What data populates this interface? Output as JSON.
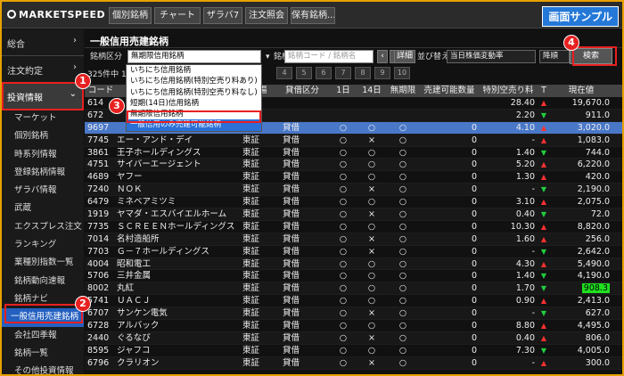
{
  "app": {
    "logo": "MARKETSPEED II",
    "sample_label": "画面サンプル"
  },
  "toolbar": {
    "buttons": [
      "個別銘柄",
      "チャート",
      "ザラバ7",
      "注文照会",
      "保有銘柄..."
    ]
  },
  "sidebar": {
    "top_items": [
      "総合",
      "注文約定",
      "投資情報"
    ],
    "items": [
      "マーケット",
      "個別銘柄",
      "時系列情報",
      "登録銘柄情報",
      "ザラバ情報",
      "武蔵",
      "エクスプレス注文",
      "ランキング",
      "業種別指数一覧",
      "銘柄動向速報",
      "銘柄ナビ",
      "一般信用売建銘柄",
      "会社四季報",
      "銘柄一覧",
      "その他投資情報"
    ],
    "selected_index": 11
  },
  "panel": {
    "title": "一般信用売建銘柄",
    "filter_label": "銘柄区分",
    "filter_value": "無期限信用銘柄",
    "stock_label": "銘柄",
    "stock_placeholder": "銘柄コード / 銘柄名",
    "detail_button": "詳細",
    "sort_label": "並び替え",
    "sort_value": "当日株価変動率",
    "order_value": "降順",
    "search_button": "検索",
    "count_text": "325件中 1",
    "pages": [
      "4",
      "5",
      "6",
      "7",
      "8",
      "9",
      "10"
    ]
  },
  "dropdown": {
    "options": [
      "いちにち信用銘柄",
      "いちにち信用銘柄(特別空売り料あり)",
      "いちにち信用銘柄(特別空売り料なし)",
      "短期(14日)信用銘柄",
      "無期限信用銘柄",
      "一般信用のみ売建可能銘柄"
    ],
    "boxed_index": 4,
    "active_index": 5
  },
  "table": {
    "columns": [
      "コード",
      "",
      "市場",
      "貸借区分",
      "1日",
      "14日",
      "無期限",
      "売建可能数量",
      "特別空売り料",
      "T",
      "現在値"
    ],
    "rows": [
      {
        "code": "614",
        "name": "",
        "market": "",
        "type": "",
        "d1": "",
        "d14": "",
        "unl": "",
        "qty": "",
        "fee": "28.40",
        "trend": "up",
        "price": "19,670.0"
      },
      {
        "code": "672",
        "name": "",
        "market": "",
        "type": "",
        "d1": "",
        "d14": "",
        "unl": "",
        "qty": "",
        "fee": "2.20",
        "trend": "down",
        "price": "911.0"
      },
      {
        "code": "9697",
        "name": "",
        "market": "東証",
        "type": "貸借",
        "d1": "○",
        "d14": "○",
        "unl": "○",
        "qty": "0",
        "fee": "4.10",
        "trend": "up",
        "price": "3,020.0"
      },
      {
        "code": "7745",
        "name": "エー・アンド・デイ",
        "market": "東証",
        "type": "貸借",
        "d1": "○",
        "d14": "×",
        "unl": "○",
        "qty": "0",
        "fee": "-",
        "trend": "up",
        "price": "1,083.0"
      },
      {
        "code": "3861",
        "name": "王子ホールディングス",
        "market": "東証",
        "type": "貸借",
        "d1": "○",
        "d14": "○",
        "unl": "○",
        "qty": "0",
        "fee": "1.40",
        "trend": "down",
        "price": "744.0"
      },
      {
        "code": "4751",
        "name": "サイバーエージェント",
        "market": "東証",
        "type": "貸借",
        "d1": "○",
        "d14": "○",
        "unl": "○",
        "qty": "0",
        "fee": "5.20",
        "trend": "up",
        "price": "6,220.0"
      },
      {
        "code": "4689",
        "name": "ヤフー",
        "market": "東証",
        "type": "貸借",
        "d1": "○",
        "d14": "○",
        "unl": "○",
        "qty": "0",
        "fee": "1.30",
        "trend": "up",
        "price": "420.0"
      },
      {
        "code": "7240",
        "name": "ＮＯＫ",
        "market": "東証",
        "type": "貸借",
        "d1": "○",
        "d14": "×",
        "unl": "○",
        "qty": "0",
        "fee": "-",
        "trend": "down",
        "price": "2,190.0"
      },
      {
        "code": "6479",
        "name": "ミネベアミツミ",
        "market": "東証",
        "type": "貸借",
        "d1": "○",
        "d14": "○",
        "unl": "○",
        "qty": "0",
        "fee": "3.10",
        "trend": "up",
        "price": "2,075.0"
      },
      {
        "code": "1919",
        "name": "ヤマダ・エスバイエルホーム",
        "market": "東証",
        "type": "貸借",
        "d1": "○",
        "d14": "×",
        "unl": "○",
        "qty": "0",
        "fee": "0.40",
        "trend": "down",
        "price": "72.0"
      },
      {
        "code": "7735",
        "name": "ＳＣＲＥＥＮホールディングス",
        "market": "東証",
        "type": "貸借",
        "d1": "○",
        "d14": "○",
        "unl": "○",
        "qty": "0",
        "fee": "10.30",
        "trend": "up",
        "price": "8,820.0"
      },
      {
        "code": "7014",
        "name": "名村造船所",
        "market": "東証",
        "type": "貸借",
        "d1": "○",
        "d14": "×",
        "unl": "○",
        "qty": "0",
        "fee": "1.60",
        "trend": "up",
        "price": "256.0"
      },
      {
        "code": "7703",
        "name": "Ｇ－７ホールディングス",
        "market": "東証",
        "type": "貸借",
        "d1": "○",
        "d14": "×",
        "unl": "○",
        "qty": "0",
        "fee": "-",
        "trend": "down",
        "price": "2,642.0"
      },
      {
        "code": "4004",
        "name": "昭和電工",
        "market": "東証",
        "type": "貸借",
        "d1": "○",
        "d14": "○",
        "unl": "○",
        "qty": "0",
        "fee": "4.30",
        "trend": "up",
        "price": "5,490.0"
      },
      {
        "code": "5706",
        "name": "三井金属",
        "market": "東証",
        "type": "貸借",
        "d1": "○",
        "d14": "○",
        "unl": "○",
        "qty": "0",
        "fee": "1.40",
        "trend": "down",
        "price": "4,190.0"
      },
      {
        "code": "8002",
        "name": "丸紅",
        "market": "東証",
        "type": "貸借",
        "d1": "○",
        "d14": "○",
        "unl": "○",
        "qty": "0",
        "fee": "1.70",
        "trend": "down",
        "price": "908.3",
        "price_highlight": true
      },
      {
        "code": "5741",
        "name": "ＵＡＣＪ",
        "market": "東証",
        "type": "貸借",
        "d1": "○",
        "d14": "○",
        "unl": "○",
        "qty": "0",
        "fee": "0.90",
        "trend": "up",
        "price": "2,413.0"
      },
      {
        "code": "6707",
        "name": "サンケン電気",
        "market": "東証",
        "type": "貸借",
        "d1": "○",
        "d14": "×",
        "unl": "○",
        "qty": "0",
        "fee": "-",
        "trend": "down",
        "price": "627.0"
      },
      {
        "code": "6728",
        "name": "アルバック",
        "market": "東証",
        "type": "貸借",
        "d1": "○",
        "d14": "○",
        "unl": "○",
        "qty": "0",
        "fee": "8.80",
        "trend": "up",
        "price": "4,495.0"
      },
      {
        "code": "2440",
        "name": "ぐるなび",
        "market": "東証",
        "type": "貸借",
        "d1": "○",
        "d14": "×",
        "unl": "○",
        "qty": "0",
        "fee": "0.40",
        "trend": "up",
        "price": "806.0"
      },
      {
        "code": "8595",
        "name": "ジャフコ",
        "market": "東証",
        "type": "貸借",
        "d1": "○",
        "d14": "○",
        "unl": "○",
        "qty": "0",
        "fee": "7.30",
        "trend": "down",
        "price": "4,005.0"
      },
      {
        "code": "6796",
        "name": "クラリオン",
        "market": "東証",
        "type": "貸借",
        "d1": "○",
        "d14": "×",
        "unl": "○",
        "qty": "0",
        "fee": "-",
        "trend": "up",
        "price": "300.0"
      }
    ]
  },
  "annotations": [
    "1",
    "2",
    "3",
    "4"
  ],
  "colors": {
    "accent": "#2460c0",
    "highlight_row": "#4a78c8",
    "annotation": "#e82020",
    "up": "#ff3030",
    "down": "#20d040"
  }
}
